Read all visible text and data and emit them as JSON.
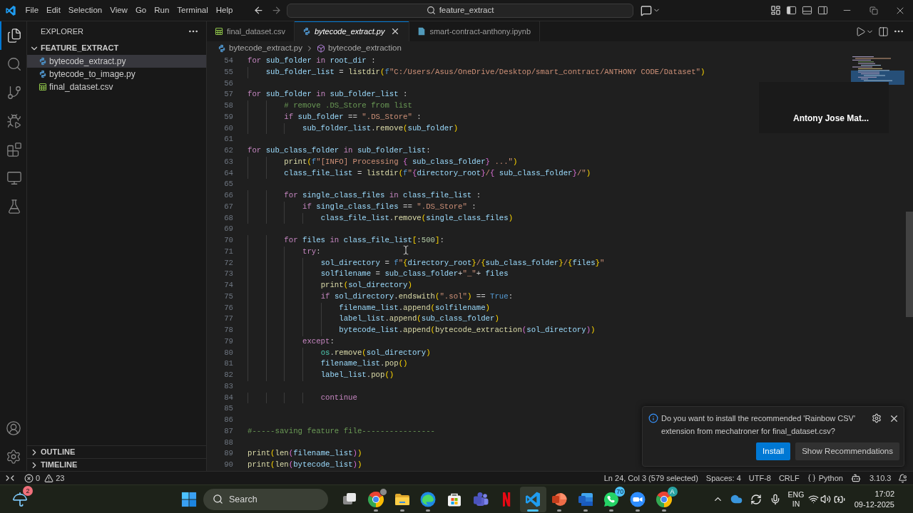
{
  "title_bar": {
    "menu": [
      "File",
      "Edit",
      "Selection",
      "View",
      "Go",
      "Run",
      "Terminal",
      "Help"
    ],
    "navigation": {
      "back": {
        "disabled": false
      },
      "forward": {
        "disabled": true
      }
    },
    "command_center": "feature_extract",
    "layout_toggles": [
      {
        "kind": "sidebar",
        "on": true
      },
      {
        "kind": "panel",
        "on": false
      },
      {
        "kind": "secondary_sidebar",
        "on": false
      }
    ]
  },
  "activity_bar": {
    "items": [
      {
        "kind": "explorer",
        "selected": true
      },
      {
        "kind": "search",
        "selected": false
      },
      {
        "kind": "source_control",
        "selected": false
      },
      {
        "kind": "run_debug",
        "selected": false
      },
      {
        "kind": "extensions",
        "selected": false
      },
      {
        "kind": "remote",
        "selected": false
      },
      {
        "kind": "testing",
        "selected": false
      }
    ],
    "bottom": [
      {
        "kind": "accounts"
      },
      {
        "kind": "manage"
      }
    ]
  },
  "sidebar": {
    "title": "EXPLORER",
    "folder": {
      "name": "FEATURE_EXTRACT",
      "expanded": true,
      "children": [
        {
          "name": "bytecode_extract.py",
          "kind": "python",
          "selected": true
        },
        {
          "name": "bytecode_to_image.py",
          "kind": "python",
          "selected": false
        },
        {
          "name": "final_dataset.csv",
          "kind": "csv",
          "selected": false
        }
      ]
    },
    "sections": [
      {
        "name": "OUTLINE",
        "expanded": false
      },
      {
        "name": "TIMELINE",
        "expanded": false
      }
    ]
  },
  "tabs": [
    {
      "label": "final_dataset.csv",
      "kind": "csv",
      "selected": false,
      "preview": false
    },
    {
      "label": "bytecode_extract.py",
      "kind": "python",
      "selected": true,
      "preview": true
    },
    {
      "label": "smart-contract-anthony.ipynb",
      "kind": "notebook",
      "selected": false,
      "preview": false
    }
  ],
  "breadcrumb": [
    {
      "label": "bytecode_extract.py",
      "kind": "python"
    },
    {
      "label": "bytecode_extraction",
      "kind": "symbol"
    }
  ],
  "editor": {
    "lines": [
      {
        "number": "54",
        "tokens": [
          {
            "text": "for ",
            "kind": "keyword"
          },
          {
            "text": "sub_folder ",
            "kind": "name"
          },
          {
            "text": "in ",
            "kind": "keyword"
          },
          {
            "text": "root_dir",
            "kind": "name"
          },
          {
            "text": " :",
            "kind": "plain"
          }
        ]
      },
      {
        "number": "55",
        "tokens": [
          {
            "text": "    sub_folder_list",
            "kind": "name"
          },
          {
            "text": " = ",
            "kind": "plain"
          },
          {
            "text": "listdir",
            "kind": "function"
          },
          {
            "text": "(",
            "kind": "bracket1"
          },
          {
            "text": "f",
            "kind": "prefix"
          },
          {
            "text": "\"C:/Users/Asus/OneDrive/Desktop/smart_contract/ANTHONY CODE/Dataset\"",
            "kind": "string"
          },
          {
            "text": ")",
            "kind": "bracket1"
          }
        ]
      },
      {
        "number": "56"
      },
      {
        "number": "57",
        "tokens": [
          {
            "text": "for ",
            "kind": "keyword"
          },
          {
            "text": "sub_folder ",
            "kind": "name"
          },
          {
            "text": "in ",
            "kind": "keyword"
          },
          {
            "text": "sub_folder_list",
            "kind": "name"
          },
          {
            "text": " :",
            "kind": "plain"
          }
        ]
      },
      {
        "number": "58",
        "tokens": [
          {
            "text": "        # remove .DS_Store from list",
            "kind": "comment"
          }
        ]
      },
      {
        "number": "59",
        "tokens": [
          {
            "text": "        if ",
            "kind": "keyword"
          },
          {
            "text": "sub_folder",
            "kind": "name"
          },
          {
            "text": " == ",
            "kind": "plain"
          },
          {
            "text": "\".DS_Store\"",
            "kind": "string"
          },
          {
            "text": " :",
            "kind": "plain"
          }
        ]
      },
      {
        "number": "60",
        "tokens": [
          {
            "text": "            sub_folder_list",
            "kind": "name"
          },
          {
            "text": ".",
            "kind": "plain"
          },
          {
            "text": "remove",
            "kind": "function"
          },
          {
            "text": "(",
            "kind": "bracket1"
          },
          {
            "text": "sub_folder",
            "kind": "name"
          },
          {
            "text": ")",
            "kind": "bracket1"
          }
        ]
      },
      {
        "number": "61"
      },
      {
        "number": "62",
        "tokens": [
          {
            "text": "for ",
            "kind": "keyword"
          },
          {
            "text": "sub_class_folder ",
            "kind": "name"
          },
          {
            "text": "in ",
            "kind": "keyword"
          },
          {
            "text": "sub_folder_list",
            "kind": "name"
          },
          {
            "text": ":",
            "kind": "plain"
          }
        ]
      },
      {
        "number": "63",
        "tokens": [
          {
            "text": "        print",
            "kind": "function"
          },
          {
            "text": "(",
            "kind": "bracket1"
          },
          {
            "text": "f",
            "kind": "prefix"
          },
          {
            "text": "\"[INFO] Processing ",
            "kind": "string"
          },
          {
            "text": "{",
            "kind": "bracket2"
          },
          {
            "text": " sub_class_folder",
            "kind": "name"
          },
          {
            "text": "}",
            "kind": "bracket2"
          },
          {
            "text": " ...\"",
            "kind": "string"
          },
          {
            "text": ")",
            "kind": "bracket1"
          }
        ]
      },
      {
        "number": "64",
        "tokens": [
          {
            "text": "        class_file_list",
            "kind": "name"
          },
          {
            "text": " = ",
            "kind": "plain"
          },
          {
            "text": "listdir",
            "kind": "function"
          },
          {
            "text": "(",
            "kind": "bracket1"
          },
          {
            "text": "f",
            "kind": "prefix"
          },
          {
            "text": "\"",
            "kind": "string"
          },
          {
            "text": "{",
            "kind": "bracket2"
          },
          {
            "text": "directory_root",
            "kind": "name"
          },
          {
            "text": "}",
            "kind": "bracket2"
          },
          {
            "text": "/",
            "kind": "string"
          },
          {
            "text": "{",
            "kind": "bracket2"
          },
          {
            "text": " sub_class_folder",
            "kind": "name"
          },
          {
            "text": "}",
            "kind": "bracket2"
          },
          {
            "text": "/\"",
            "kind": "string"
          },
          {
            "text": ")",
            "kind": "bracket1"
          }
        ]
      },
      {
        "number": "65"
      },
      {
        "number": "66",
        "tokens": [
          {
            "text": "        for ",
            "kind": "keyword"
          },
          {
            "text": "single_class_files ",
            "kind": "name"
          },
          {
            "text": "in ",
            "kind": "keyword"
          },
          {
            "text": "class_file_list",
            "kind": "name"
          },
          {
            "text": " :",
            "kind": "plain"
          }
        ]
      },
      {
        "number": "67",
        "tokens": [
          {
            "text": "            if ",
            "kind": "keyword"
          },
          {
            "text": "single_class_files",
            "kind": "name"
          },
          {
            "text": " == ",
            "kind": "plain"
          },
          {
            "text": "\".DS_Store\"",
            "kind": "string"
          },
          {
            "text": " :",
            "kind": "plain"
          }
        ]
      },
      {
        "number": "68",
        "tokens": [
          {
            "text": "                class_file_list",
            "kind": "name"
          },
          {
            "text": ".",
            "kind": "plain"
          },
          {
            "text": "remove",
            "kind": "function"
          },
          {
            "text": "(",
            "kind": "bracket1"
          },
          {
            "text": "single_class_files",
            "kind": "name"
          },
          {
            "text": ")",
            "kind": "bracket1"
          }
        ]
      },
      {
        "number": "69"
      },
      {
        "number": "70",
        "tokens": [
          {
            "text": "        for ",
            "kind": "keyword"
          },
          {
            "text": "files ",
            "kind": "name"
          },
          {
            "text": "in ",
            "kind": "keyword"
          },
          {
            "text": "class_file_list",
            "kind": "name"
          },
          {
            "text": "[",
            "kind": "bracket1"
          },
          {
            "text": ":",
            "kind": "plain"
          },
          {
            "text": "500",
            "kind": "number"
          },
          {
            "text": "]",
            "kind": "bracket1"
          },
          {
            "text": ":",
            "kind": "plain"
          }
        ]
      },
      {
        "number": "71",
        "tokens": [
          {
            "text": "            try",
            "kind": "keyword"
          },
          {
            "text": ":",
            "kind": "plain"
          }
        ]
      },
      {
        "number": "72",
        "tokens": [
          {
            "text": "                sol_directory",
            "kind": "name"
          },
          {
            "text": " = ",
            "kind": "plain"
          },
          {
            "text": "f",
            "kind": "prefix"
          },
          {
            "text": "\"",
            "kind": "string"
          },
          {
            "text": "{",
            "kind": "bracket1"
          },
          {
            "text": "directory_root",
            "kind": "name"
          },
          {
            "text": "}",
            "kind": "bracket1"
          },
          {
            "text": "/",
            "kind": "string"
          },
          {
            "text": "{",
            "kind": "bracket1"
          },
          {
            "text": "sub_class_folder",
            "kind": "name"
          },
          {
            "text": "}",
            "kind": "bracket1"
          },
          {
            "text": "/",
            "kind": "string"
          },
          {
            "text": "{",
            "kind": "bracket1"
          },
          {
            "text": "files",
            "kind": "name"
          },
          {
            "text": "}",
            "kind": "bracket1"
          },
          {
            "text": "\"",
            "kind": "string"
          }
        ]
      },
      {
        "number": "73",
        "tokens": [
          {
            "text": "                solfilename",
            "kind": "name"
          },
          {
            "text": " = ",
            "kind": "plain"
          },
          {
            "text": "sub_class_folder",
            "kind": "name"
          },
          {
            "text": "+",
            "kind": "plain"
          },
          {
            "text": "\"_\"",
            "kind": "string"
          },
          {
            "text": "+ ",
            "kind": "plain"
          },
          {
            "text": "files",
            "kind": "name"
          }
        ]
      },
      {
        "number": "74",
        "tokens": [
          {
            "text": "                print",
            "kind": "function"
          },
          {
            "text": "(",
            "kind": "bracket1"
          },
          {
            "text": "sol_directory",
            "kind": "name"
          },
          {
            "text": ")",
            "kind": "bracket1"
          }
        ]
      },
      {
        "number": "75",
        "tokens": [
          {
            "text": "                if ",
            "kind": "keyword"
          },
          {
            "text": "sol_directory",
            "kind": "name"
          },
          {
            "text": ".",
            "kind": "plain"
          },
          {
            "text": "endswith",
            "kind": "function"
          },
          {
            "text": "(",
            "kind": "bracket1"
          },
          {
            "text": "\".sol\"",
            "kind": "string"
          },
          {
            "text": ")",
            "kind": "bracket1"
          },
          {
            "text": " == ",
            "kind": "plain"
          },
          {
            "text": "True",
            "kind": "constant"
          },
          {
            "text": ":",
            "kind": "plain"
          }
        ]
      },
      {
        "number": "76",
        "tokens": [
          {
            "text": "                    filename_list",
            "kind": "name"
          },
          {
            "text": ".",
            "kind": "plain"
          },
          {
            "text": "append",
            "kind": "function"
          },
          {
            "text": "(",
            "kind": "bracket1"
          },
          {
            "text": "solfilename",
            "kind": "name"
          },
          {
            "text": ")",
            "kind": "bracket1"
          }
        ]
      },
      {
        "number": "77",
        "tokens": [
          {
            "text": "                    label_list",
            "kind": "name"
          },
          {
            "text": ".",
            "kind": "plain"
          },
          {
            "text": "append",
            "kind": "function"
          },
          {
            "text": "(",
            "kind": "bracket1"
          },
          {
            "text": "sub_class_folder",
            "kind": "name"
          },
          {
            "text": ")",
            "kind": "bracket1"
          }
        ]
      },
      {
        "number": "78",
        "tokens": [
          {
            "text": "                    bytecode_list",
            "kind": "name"
          },
          {
            "text": ".",
            "kind": "plain"
          },
          {
            "text": "append",
            "kind": "function"
          },
          {
            "text": "(",
            "kind": "bracket1"
          },
          {
            "text": "bytecode_extraction",
            "kind": "function"
          },
          {
            "text": "(",
            "kind": "bracket2"
          },
          {
            "text": "sol_directory",
            "kind": "name"
          },
          {
            "text": ")",
            "kind": "bracket2"
          },
          {
            "text": ")",
            "kind": "bracket1"
          }
        ]
      },
      {
        "number": "79",
        "tokens": [
          {
            "text": "            except",
            "kind": "keyword"
          },
          {
            "text": ":",
            "kind": "plain"
          }
        ]
      },
      {
        "number": "80",
        "tokens": [
          {
            "text": "                os",
            "kind": "module"
          },
          {
            "text": ".",
            "kind": "plain"
          },
          {
            "text": "remove",
            "kind": "function"
          },
          {
            "text": "(",
            "kind": "bracket1"
          },
          {
            "text": "sol_directory",
            "kind": "name"
          },
          {
            "text": ")",
            "kind": "bracket1"
          }
        ]
      },
      {
        "number": "81",
        "tokens": [
          {
            "text": "                filename_list",
            "kind": "name"
          },
          {
            "text": ".",
            "kind": "plain"
          },
          {
            "text": "pop",
            "kind": "function"
          },
          {
            "text": "()",
            "kind": "bracket1"
          }
        ]
      },
      {
        "number": "82",
        "tokens": [
          {
            "text": "                label_list",
            "kind": "name"
          },
          {
            "text": ".",
            "kind": "plain"
          },
          {
            "text": "pop",
            "kind": "function"
          },
          {
            "text": "()",
            "kind": "bracket1"
          }
        ]
      },
      {
        "number": "83"
      },
      {
        "number": "84",
        "tokens": [
          {
            "text": "                continue",
            "kind": "keyword"
          }
        ]
      },
      {
        "number": "85"
      },
      {
        "number": "86"
      },
      {
        "number": "87",
        "tokens": [
          {
            "text": "#-----saving feature file----------------",
            "kind": "comment"
          }
        ]
      },
      {
        "number": "88"
      },
      {
        "number": "89",
        "tokens": [
          {
            "text": "print",
            "kind": "function"
          },
          {
            "text": "(",
            "kind": "bracket1"
          },
          {
            "text": "len",
            "kind": "function"
          },
          {
            "text": "(",
            "kind": "bracket2"
          },
          {
            "text": "filename_list",
            "kind": "name"
          },
          {
            "text": ")",
            "kind": "bracket2"
          },
          {
            "text": ")",
            "kind": "bracket1"
          }
        ]
      },
      {
        "number": "90",
        "tokens": [
          {
            "text": "print",
            "kind": "function"
          },
          {
            "text": "(",
            "kind": "bracket1"
          },
          {
            "text": "len",
            "kind": "function"
          },
          {
            "text": "(",
            "kind": "bracket2"
          },
          {
            "text": "bytecode_list",
            "kind": "name"
          },
          {
            "text": ")",
            "kind": "bracket2"
          },
          {
            "text": ")",
            "kind": "bracket1"
          }
        ]
      }
    ]
  },
  "participant_tile": {
    "name": "Antony Jose Mat..."
  },
  "notification": {
    "message": "Do you want to install the recommended 'Rainbow CSV' extension from mechatroner for final_dataset.csv?",
    "buttons": [
      {
        "label": "Install",
        "kind": "primary"
      },
      {
        "label": "Show Recommendations",
        "kind": "secondary"
      }
    ]
  },
  "status_bar": {
    "errors": "0",
    "warnings": "23",
    "position": "Ln 24, Col 3 (579 selected)",
    "indentation": "Spaces: 4",
    "encoding": "UTF-8",
    "line_ending": "CRLF",
    "language": "Python",
    "interpreter": "3.10.3"
  },
  "taskbar": {
    "weather": {
      "badge": "2"
    },
    "search": {
      "placeholder": "Search"
    },
    "apps": [
      {
        "kind": "task_view",
        "running": false,
        "selected": false
      },
      {
        "kind": "chrome",
        "running": true,
        "selected": false,
        "profile_photo": true
      },
      {
        "kind": "explorer",
        "running": true,
        "selected": false
      },
      {
        "kind": "edge",
        "running": true,
        "selected": false
      },
      {
        "kind": "store",
        "running": false,
        "selected": false
      },
      {
        "kind": "teams",
        "running": false,
        "selected": false
      },
      {
        "kind": "netflix",
        "running": false,
        "selected": false
      },
      {
        "kind": "vscode",
        "running": true,
        "selected": true
      },
      {
        "kind": "powerpoint",
        "running": true,
        "selected": false
      },
      {
        "kind": "word",
        "running": true,
        "selected": false
      },
      {
        "kind": "whatsapp",
        "running": true,
        "selected": false,
        "badge": "70"
      },
      {
        "kind": "zoom",
        "running": true,
        "selected": false
      },
      {
        "kind": "chrome",
        "running": true,
        "selected": false,
        "badge": "A"
      }
    ],
    "tray": {
      "language": "ENG",
      "region": "IN"
    },
    "clock": {
      "time": "17:02",
      "date": "09-12-2025"
    }
  }
}
